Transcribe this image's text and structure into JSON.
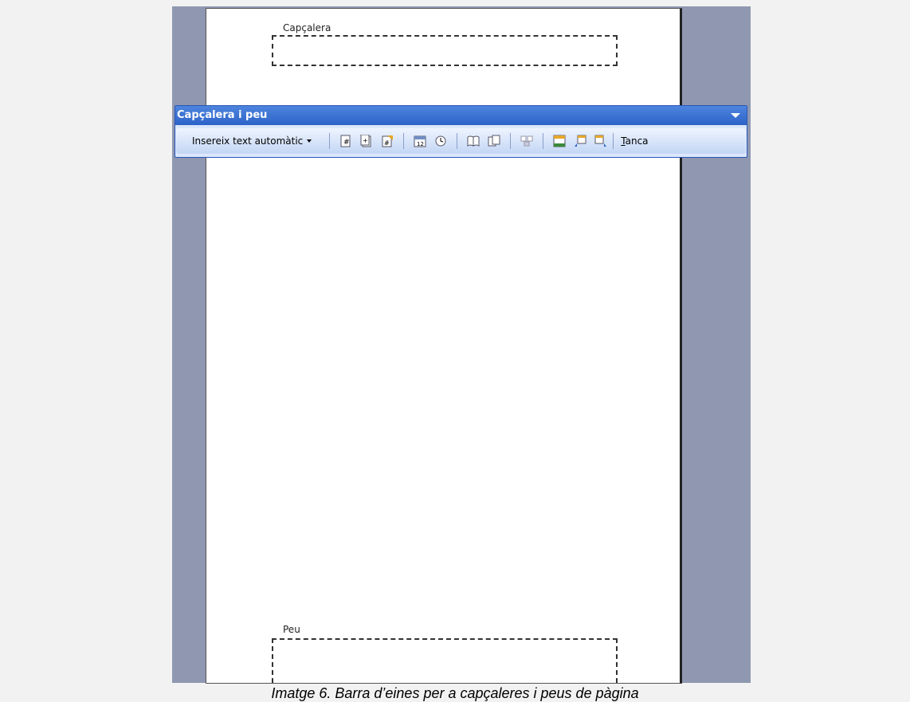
{
  "document": {
    "header_label": "Capçalera",
    "footer_label": "Peu"
  },
  "toolbar": {
    "title": "Capçalera i peu",
    "insert_autotext_label": "Insereix text automàtic",
    "close_label_first": "T",
    "close_label_rest": "anca",
    "icons": [
      "insert-page-number-icon",
      "insert-number-of-pages-icon",
      "format-page-number-icon",
      "insert-date-icon",
      "insert-time-icon",
      "page-setup-icon",
      "show-hide-document-text-icon",
      "link-to-previous-icon",
      "switch-header-footer-icon",
      "show-previous-icon",
      "show-next-icon"
    ]
  },
  "caption": "Imatge 6. Barra d’eines per a capçaleres i peus de pàgina",
  "colors": {
    "toolbar_title": "#2d63c8",
    "workspace": "#8f98b0",
    "background": "#f2f2f2"
  }
}
